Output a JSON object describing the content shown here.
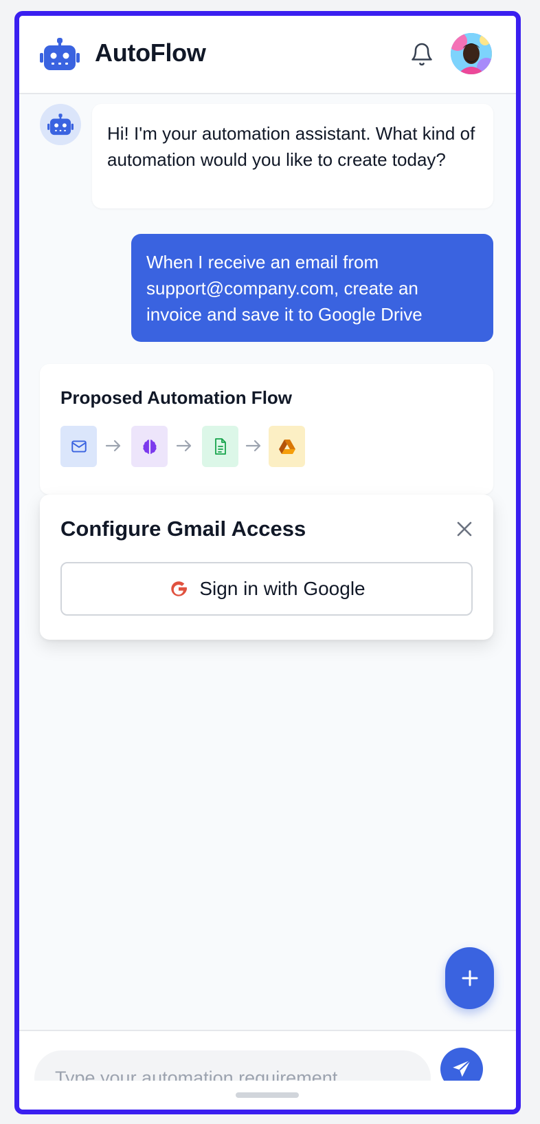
{
  "header": {
    "title": "AutoFlow",
    "logo_icon": "robot-icon",
    "notification_icon": "bell-icon",
    "avatar": "user-avatar"
  },
  "chat": {
    "messages": [
      {
        "role": "assistant",
        "text": "Hi! I'm your automation assistant. What kind of automation would you like to create today?"
      },
      {
        "role": "user",
        "text": "When I receive an email from support@company.com, create an invoice and save it to Google Drive"
      }
    ]
  },
  "flow": {
    "title": "Proposed Automation Flow",
    "steps": [
      {
        "icon": "mail-icon",
        "bg": "#dbe6fb",
        "color": "#3a63e0"
      },
      {
        "icon": "brain-icon",
        "bg": "#ede5fb",
        "color": "#7c3aed"
      },
      {
        "icon": "document-icon",
        "bg": "#dcf7e8",
        "color": "#16a34a"
      },
      {
        "icon": "google-drive-icon",
        "bg": "#fcefc4",
        "color": "#d97706"
      }
    ]
  },
  "config": {
    "title": "Configure Gmail Access",
    "google_button_label": "Sign in with Google"
  },
  "composer": {
    "placeholder": "Type your automation requirement..."
  },
  "colors": {
    "accent": "#3a63e0",
    "frame_border": "#3a1ff0"
  }
}
